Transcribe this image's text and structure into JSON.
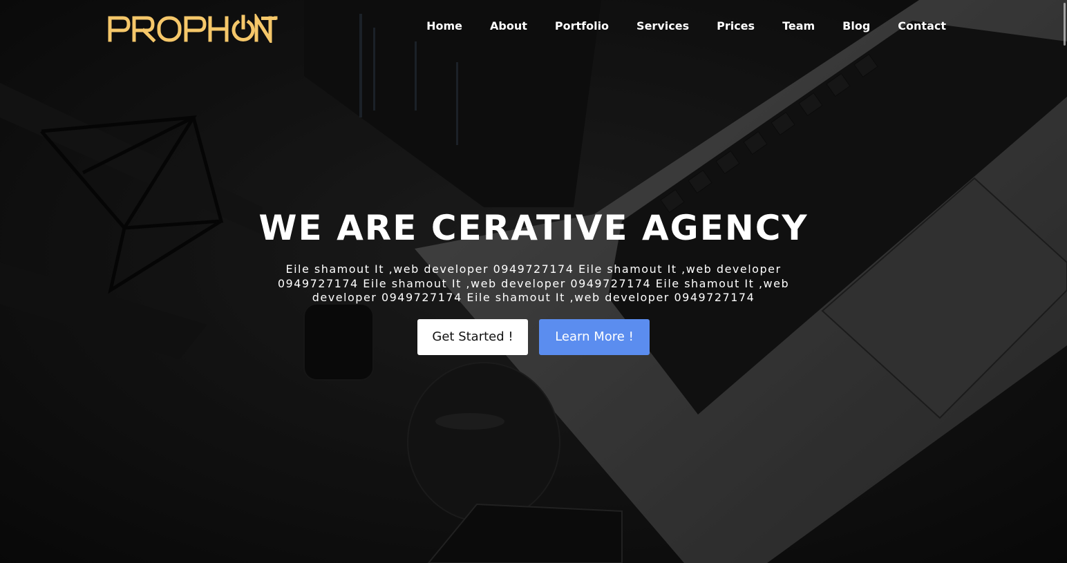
{
  "brand": {
    "logo_text": "PROPHONE",
    "logo_color": "#f5c76a"
  },
  "nav": {
    "items": [
      {
        "label": "Home"
      },
      {
        "label": "About"
      },
      {
        "label": "Portfolio"
      },
      {
        "label": "Services"
      },
      {
        "label": "Prices"
      },
      {
        "label": "Team"
      },
      {
        "label": "Blog"
      },
      {
        "label": "Contact"
      }
    ]
  },
  "hero": {
    "headline": "WE ARE CERATIVE AGENCY",
    "description": "Eile shamout It ,web developer 0949727174 Eile shamout It ,web developer 0949727174 Eile shamout It ,web developer 0949727174 Eile shamout It ,web developer 0949727174 Eile shamout It ,web developer 0949727174",
    "primary_button": "Get Started !",
    "secondary_button": "Learn More !",
    "accent_color": "#5b8def"
  }
}
